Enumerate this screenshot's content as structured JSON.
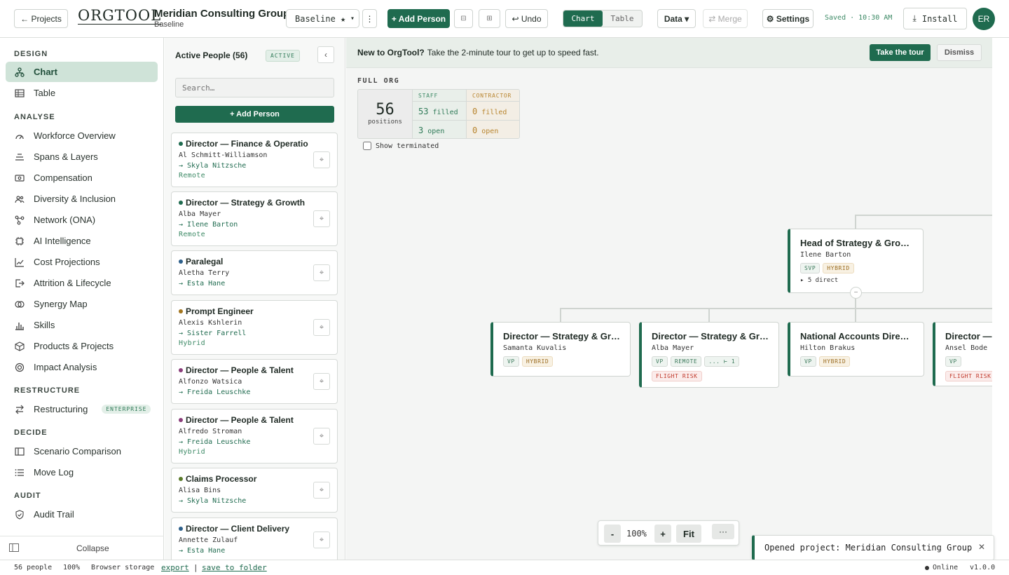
{
  "topbar": {
    "back": "← Projects",
    "logo": "ORGTOOL",
    "project": "Meridian Consulting Group",
    "sub": "Baseline",
    "scenario": "Baseline ★",
    "add": "+ Add Person",
    "undo": "↩ Undo",
    "chart": "Chart",
    "table": "Table",
    "data": "Data ▾",
    "merge": "⇄ Merge",
    "settings": "⚙ Settings",
    "saved": "Saved · 10:30 AM",
    "install": "Install",
    "avatar": "ER"
  },
  "sidebar": {
    "s1": "DESIGN",
    "s2": "ANALYSE",
    "s3": "RESTRUCTURE",
    "s4": "DECIDE",
    "s5": "AUDIT",
    "design": [
      "Chart",
      "Table"
    ],
    "analyse": [
      "Workforce Overview",
      "Spans & Layers",
      "Compensation",
      "Diversity & Inclusion",
      "Network (ONA)",
      "AI Intelligence",
      "Cost Projections",
      "Attrition & Lifecycle",
      "Synergy Map",
      "Skills",
      "Products & Projects",
      "Impact Analysis"
    ],
    "restructure": "Restructuring",
    "enterprise": "ENTERPRISE",
    "decide": [
      "Scenario Comparison",
      "Move Log"
    ],
    "audit": "Audit Trail",
    "collapse": "Collapse"
  },
  "panel": {
    "title": "Active People (56)",
    "badge": "ACTIVE",
    "search_placeholder": "Search…",
    "add": "+ Add Person",
    "cards": [
      {
        "title": "Director — Finance & Operatio…",
        "name": "Al Schmitt-Williamson",
        "manager": "→ Skyla Nitzsche",
        "work": "Remote",
        "dot": "#1f6b4f"
      },
      {
        "title": "Director — Strategy & Growth",
        "name": "Alba Mayer",
        "manager": "→ Ilene Barton",
        "work": "Remote",
        "dot": "#1f6b4f"
      },
      {
        "title": "Paralegal",
        "name": "Aletha Terry",
        "manager": "→ Esta Hane",
        "work": "",
        "dot": "#2d5f8a"
      },
      {
        "title": "Prompt Engineer",
        "name": "Alexis Kshlerin",
        "manager": "→ Sister Farrell",
        "work": "Hybrid",
        "dot": "#a3761f"
      },
      {
        "title": "Director — People & Talent",
        "name": "Alfonzo Watsica",
        "manager": "→ Freida Leuschke",
        "work": "",
        "dot": "#8a3d7a"
      },
      {
        "title": "Director — People & Talent",
        "name": "Alfredo Stroman",
        "manager": "→ Freida Leuschke",
        "work": "Hybrid",
        "dot": "#8a3d7a"
      },
      {
        "title": "Claims Processor",
        "name": "Alisa Bins",
        "manager": "→ Skyla Nitzsche",
        "work": "",
        "dot": "#5a7a2a"
      },
      {
        "title": "Director — Client Delivery",
        "name": "Annette Zulauf",
        "manager": "→ Esta Hane",
        "work": "",
        "dot": "#2d5f8a"
      }
    ]
  },
  "canvas": {
    "banner_bold": "New to OrgTool?",
    "banner_text": "Take the 2-minute tour to get up to speed fast.",
    "tour": "Take the tour",
    "dismiss": "Dismiss",
    "full_org": "FULL ORG",
    "positions": "56",
    "positions_label": "positions",
    "staff": "STAFF",
    "contractor": "CONTRACTOR",
    "staff_filled": "53",
    "staff_open": "3",
    "con_filled": "0",
    "con_open": "0",
    "filled": "filled",
    "open": "open",
    "show_terminated": "Show terminated",
    "head": {
      "title": "Head of Strategy & Growth",
      "name": "Ilene Barton",
      "tags": [
        "SVP",
        "HYBRID"
      ],
      "direct": "▸ 5 direct"
    },
    "children": [
      {
        "title": "Director — Strategy & Gro…",
        "name": "Samanta Kuvalis",
        "tags": [
          "VP",
          "HYBRID"
        ],
        "extra": ""
      },
      {
        "title": "Director — Strategy & Gro…",
        "name": "Alba Mayer",
        "tags": [
          "VP",
          "REMOTE",
          "... ⊢ 1"
        ],
        "extra": "FLIGHT RISK"
      },
      {
        "title": "National Accounts Director",
        "name": "Hilton Brakus",
        "tags": [
          "VP",
          "HYBRID"
        ],
        "extra": ""
      },
      {
        "title": "Director — S",
        "name": "Ansel Bode",
        "tags": [
          "VP"
        ],
        "extra": "FLIGHT RISK"
      }
    ],
    "zoom": "100%",
    "fit": "Fit",
    "minus": "-",
    "plus": "+",
    "more": "···",
    "toast": "Opened project: Meridian Consulting Group"
  },
  "status": {
    "people": "56 people",
    "zoom": "100%",
    "storage": "Browser storage",
    "export": "export",
    "sep": "|",
    "save": "save to folder",
    "online": "Online",
    "version": "v1.0.0"
  }
}
